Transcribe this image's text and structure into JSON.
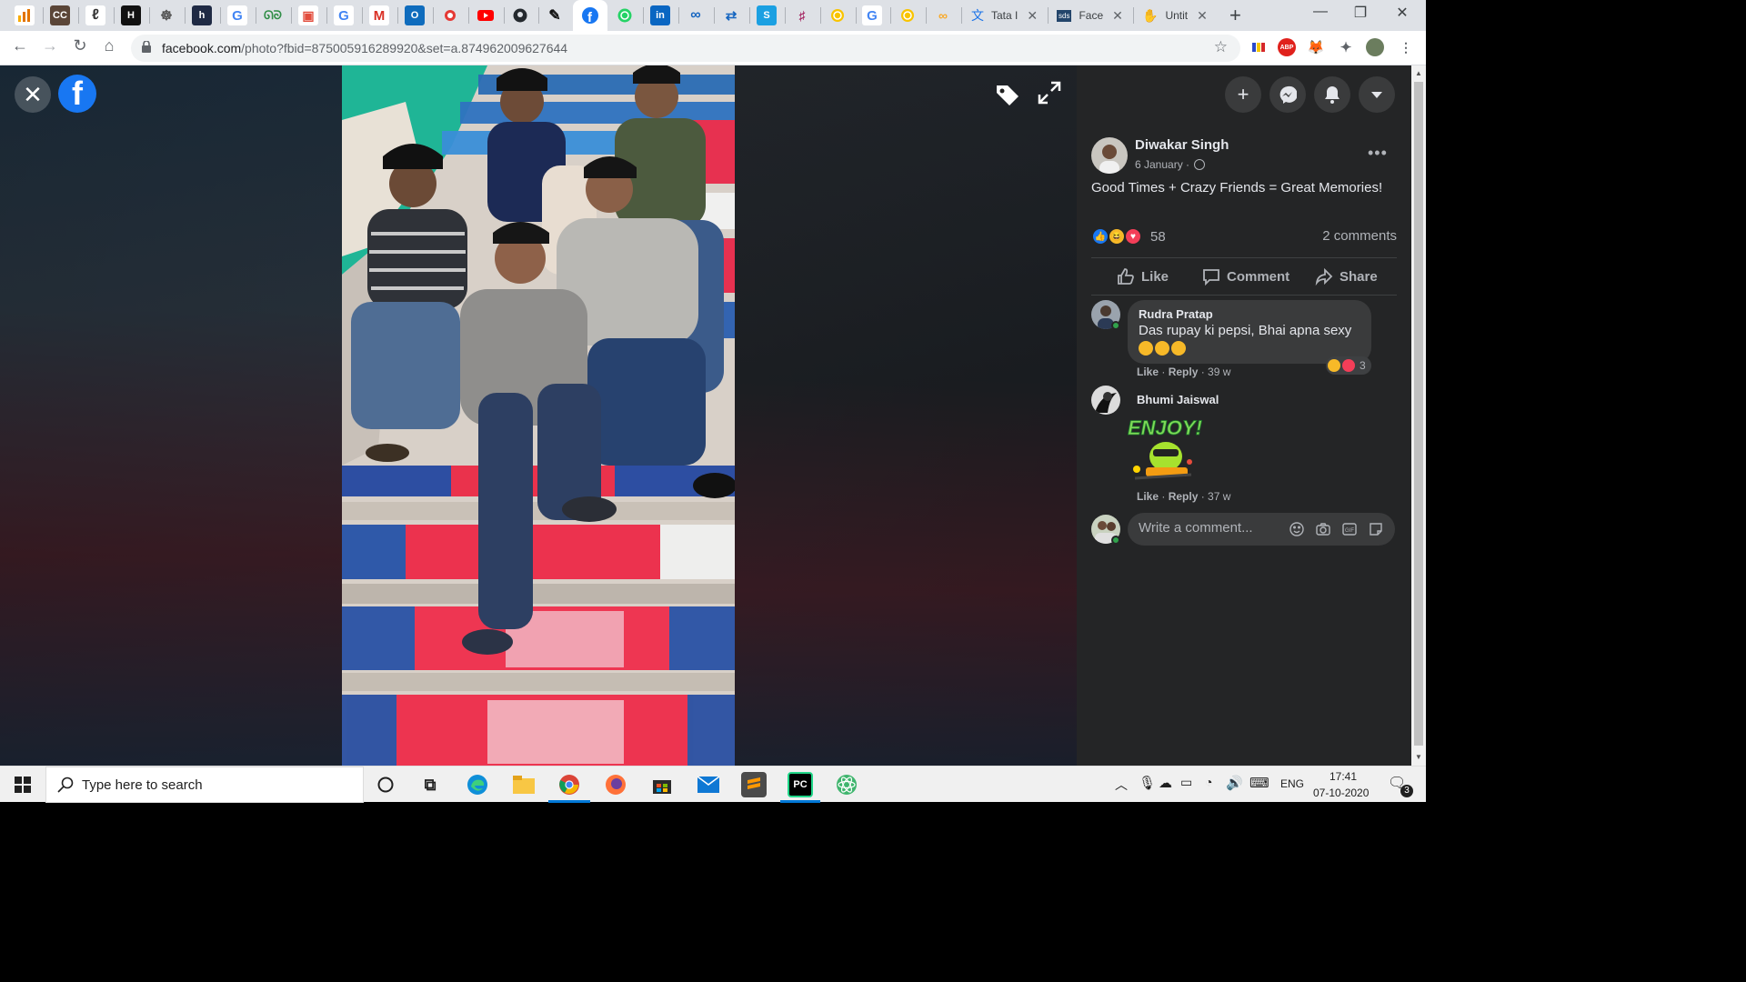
{
  "browser": {
    "url_host": "facebook.com",
    "url_path": "/photo?fbid=875005916289920&set=a.874962009627644",
    "named_tabs": [
      {
        "label": "Tata I",
        "icon": "translate-icon"
      },
      {
        "label": "Face",
        "icon": "sds-icon"
      },
      {
        "label": "Untit",
        "icon": "hand-icon"
      }
    ]
  },
  "viewer": {
    "logo_letter": "f"
  },
  "post": {
    "author": "Diwakar Singh",
    "date": "6 January ·",
    "caption": "Good Times + Crazy Friends = Great Memories!",
    "reaction_count": "58",
    "comments_count": "2 comments",
    "actions": {
      "like": "Like",
      "comment": "Comment",
      "share": "Share"
    }
  },
  "comments": [
    {
      "name": "Rudra Pratap",
      "text": "Das rupay ki pepsi, Bhai apna sexy",
      "like": "Like",
      "reply": "Reply",
      "age": "39 w",
      "reaction_count": "3"
    },
    {
      "name": "Bhumi Jaiswal",
      "sticker_text": "ENJOY!",
      "like": "Like",
      "reply": "Reply",
      "age": "37 w"
    }
  ],
  "composer": {
    "placeholder": "Write a comment..."
  },
  "taskbar": {
    "search_placeholder": "Type here to search",
    "language": "ENG",
    "time": "17:41",
    "date": "07-10-2020",
    "notification_count": "3"
  },
  "colors": {
    "facebook_blue": "#1877f2",
    "panel_bg": "#242526",
    "bubble_bg": "#3a3b3c"
  }
}
